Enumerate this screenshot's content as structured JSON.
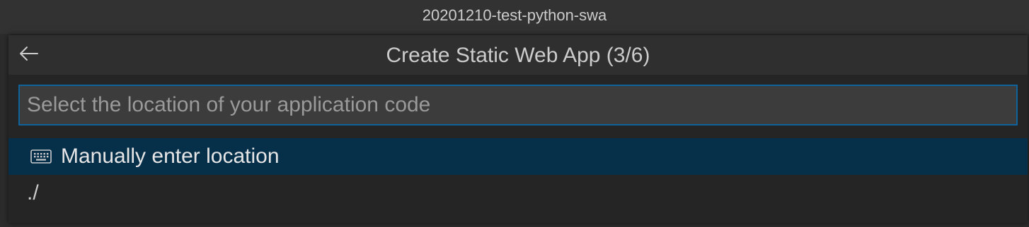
{
  "window": {
    "title": "20201210-test-python-swa"
  },
  "quick_pick": {
    "title": "Create Static Web App (3/6)",
    "back_icon": "arrow-left-icon",
    "input": {
      "placeholder": "Select the location of your application code",
      "value": ""
    },
    "items": [
      {
        "label": "Manually enter location",
        "icon": "keyboard-icon",
        "selected": true
      },
      {
        "label": "./",
        "selected": false
      }
    ]
  },
  "colors": {
    "focus_border": "#0e639c",
    "selected_item_bg": "#062f4a",
    "panel_bg": "#252526"
  }
}
